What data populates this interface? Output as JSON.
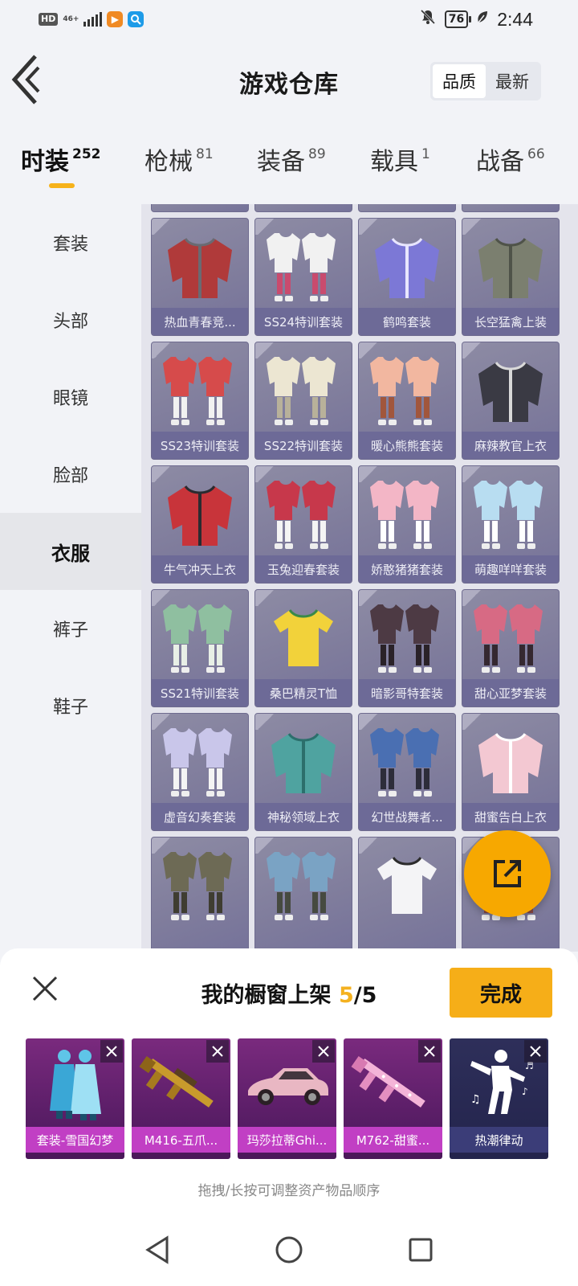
{
  "status_bar": {
    "hd": "HD",
    "network": "46+",
    "battery": "76",
    "time": "2:44"
  },
  "header": {
    "title": "游戏仓库",
    "sort_options": [
      "品质",
      "最新"
    ],
    "sort_active": "品质"
  },
  "tabs": [
    {
      "label": "时装",
      "count": "252",
      "active": true
    },
    {
      "label": "枪械",
      "count": "81",
      "active": false
    },
    {
      "label": "装备",
      "count": "89",
      "active": false
    },
    {
      "label": "载具",
      "count": "1",
      "active": false
    },
    {
      "label": "战备",
      "count": "66",
      "active": false
    }
  ],
  "side_menu": [
    {
      "label": "套装",
      "active": false
    },
    {
      "label": "头部",
      "active": false
    },
    {
      "label": "眼镜",
      "active": false
    },
    {
      "label": "脸部",
      "active": false
    },
    {
      "label": "衣服",
      "active": true
    },
    {
      "label": "裤子",
      "active": false
    },
    {
      "label": "鞋子",
      "active": false
    }
  ],
  "items": [
    {
      "name": "热血青春竞...",
      "art": "jacket-red-grey"
    },
    {
      "name": "SS24特训套装",
      "art": "set-white"
    },
    {
      "name": "鹤鸣套装",
      "art": "hoodie-purple"
    },
    {
      "name": "长空猛禽上装",
      "art": "jacket-camo"
    },
    {
      "name": "SS23特训套装",
      "art": "set-red-white"
    },
    {
      "name": "SS22特训套装",
      "art": "set-cream"
    },
    {
      "name": "暖心熊熊套装",
      "art": "set-peach"
    },
    {
      "name": "麻辣教官上衣",
      "art": "coat-striped"
    },
    {
      "name": "牛气冲天上衣",
      "art": "hoodie-red-black"
    },
    {
      "name": "玉兔迎春套装",
      "art": "set-red-rabbit"
    },
    {
      "name": "娇憨猪猪套装",
      "art": "set-pink"
    },
    {
      "name": "萌趣咩咩套装",
      "art": "set-lightblue"
    },
    {
      "name": "SS21特训套装",
      "art": "set-green"
    },
    {
      "name": "桑巴精灵T恤",
      "art": "tshirt-yellow"
    },
    {
      "name": "暗影哥特套装",
      "art": "set-dark"
    },
    {
      "name": "甜心亚梦套装",
      "art": "set-pink-dark"
    },
    {
      "name": "虚音幻奏套装",
      "art": "set-lavender"
    },
    {
      "name": "神秘领域上衣",
      "art": "shirt-teal"
    },
    {
      "name": "幻世战舞者...",
      "art": "set-blue"
    },
    {
      "name": "甜蜜告白上衣",
      "art": "jacket-pink"
    },
    {
      "name": "",
      "art": "set-olive"
    },
    {
      "name": "",
      "art": "set-camo-blue"
    },
    {
      "name": "",
      "art": "tank-white"
    },
    {
      "name": "",
      "art": "set-black"
    }
  ],
  "panel": {
    "title": "我的橱窗上架",
    "count_current": "5",
    "count_total": "/5",
    "done_label": "完成",
    "hint": "拖拽/长按可调整资产物品顺序",
    "showcase": [
      {
        "label": "套装-雪国幻梦",
        "art": "outfit-icon"
      },
      {
        "label": "M416-五爪...",
        "art": "rifle-icon"
      },
      {
        "label": "玛莎拉蒂Ghi...",
        "art": "car-icon"
      },
      {
        "label": "M762-甜蜜...",
        "art": "rifle-pink-icon"
      },
      {
        "label": "热潮律动",
        "art": "dance-emote-icon"
      }
    ]
  },
  "colors": {
    "accent": "#f6ae18",
    "card_bg": "#7f7c9c",
    "showcase_bg": "#5e1f6a"
  }
}
